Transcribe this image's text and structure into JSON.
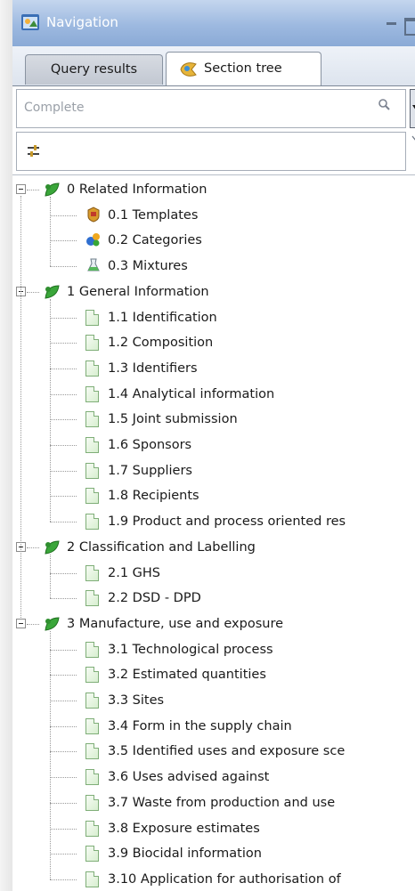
{
  "window": {
    "title": "Navigation"
  },
  "tabs": {
    "query_results": "Query results",
    "section_tree": "Section tree"
  },
  "search": {
    "placeholder": "Complete"
  },
  "tree": {
    "groups": [
      {
        "label": "0 Related Information",
        "children": [
          {
            "label": "0.1 Templates",
            "icon": "templates-icon"
          },
          {
            "label": "0.2 Categories",
            "icon": "categories-icon"
          },
          {
            "label": "0.3 Mixtures",
            "icon": "mixtures-icon"
          }
        ]
      },
      {
        "label": "1 General Information",
        "children": [
          {
            "label": "1.1 Identification",
            "icon": "document-icon"
          },
          {
            "label": "1.2 Composition",
            "icon": "document-icon"
          },
          {
            "label": "1.3 Identifiers",
            "icon": "document-icon"
          },
          {
            "label": "1.4 Analytical information",
            "icon": "document-icon"
          },
          {
            "label": "1.5 Joint submission",
            "icon": "document-icon"
          },
          {
            "label": "1.6 Sponsors",
            "icon": "document-icon"
          },
          {
            "label": "1.7 Suppliers",
            "icon": "document-icon"
          },
          {
            "label": "1.8 Recipients",
            "icon": "document-icon"
          },
          {
            "label": "1.9 Product and process oriented res",
            "icon": "document-icon"
          }
        ]
      },
      {
        "label": "2 Classification and Labelling",
        "children": [
          {
            "label": "2.1 GHS",
            "icon": "document-icon"
          },
          {
            "label": "2.2 DSD - DPD",
            "icon": "document-icon"
          }
        ]
      },
      {
        "label": "3 Manufacture, use and exposure",
        "children": [
          {
            "label": "3.1 Technological process",
            "icon": "document-icon"
          },
          {
            "label": "3.2 Estimated quantities",
            "icon": "document-icon"
          },
          {
            "label": "3.3 Sites",
            "icon": "document-icon"
          },
          {
            "label": "3.4 Form in the supply chain",
            "icon": "document-icon"
          },
          {
            "label": "3.5 Identified uses and exposure sce",
            "icon": "document-icon"
          },
          {
            "label": "3.6 Uses advised against",
            "icon": "document-icon"
          },
          {
            "label": "3.7 Waste from production and use",
            "icon": "document-icon"
          },
          {
            "label": "3.8 Exposure estimates",
            "icon": "document-icon"
          },
          {
            "label": "3.9 Biocidal information",
            "icon": "document-icon"
          },
          {
            "label": "3.10 Application for authorisation of",
            "icon": "document-icon"
          }
        ]
      }
    ]
  }
}
